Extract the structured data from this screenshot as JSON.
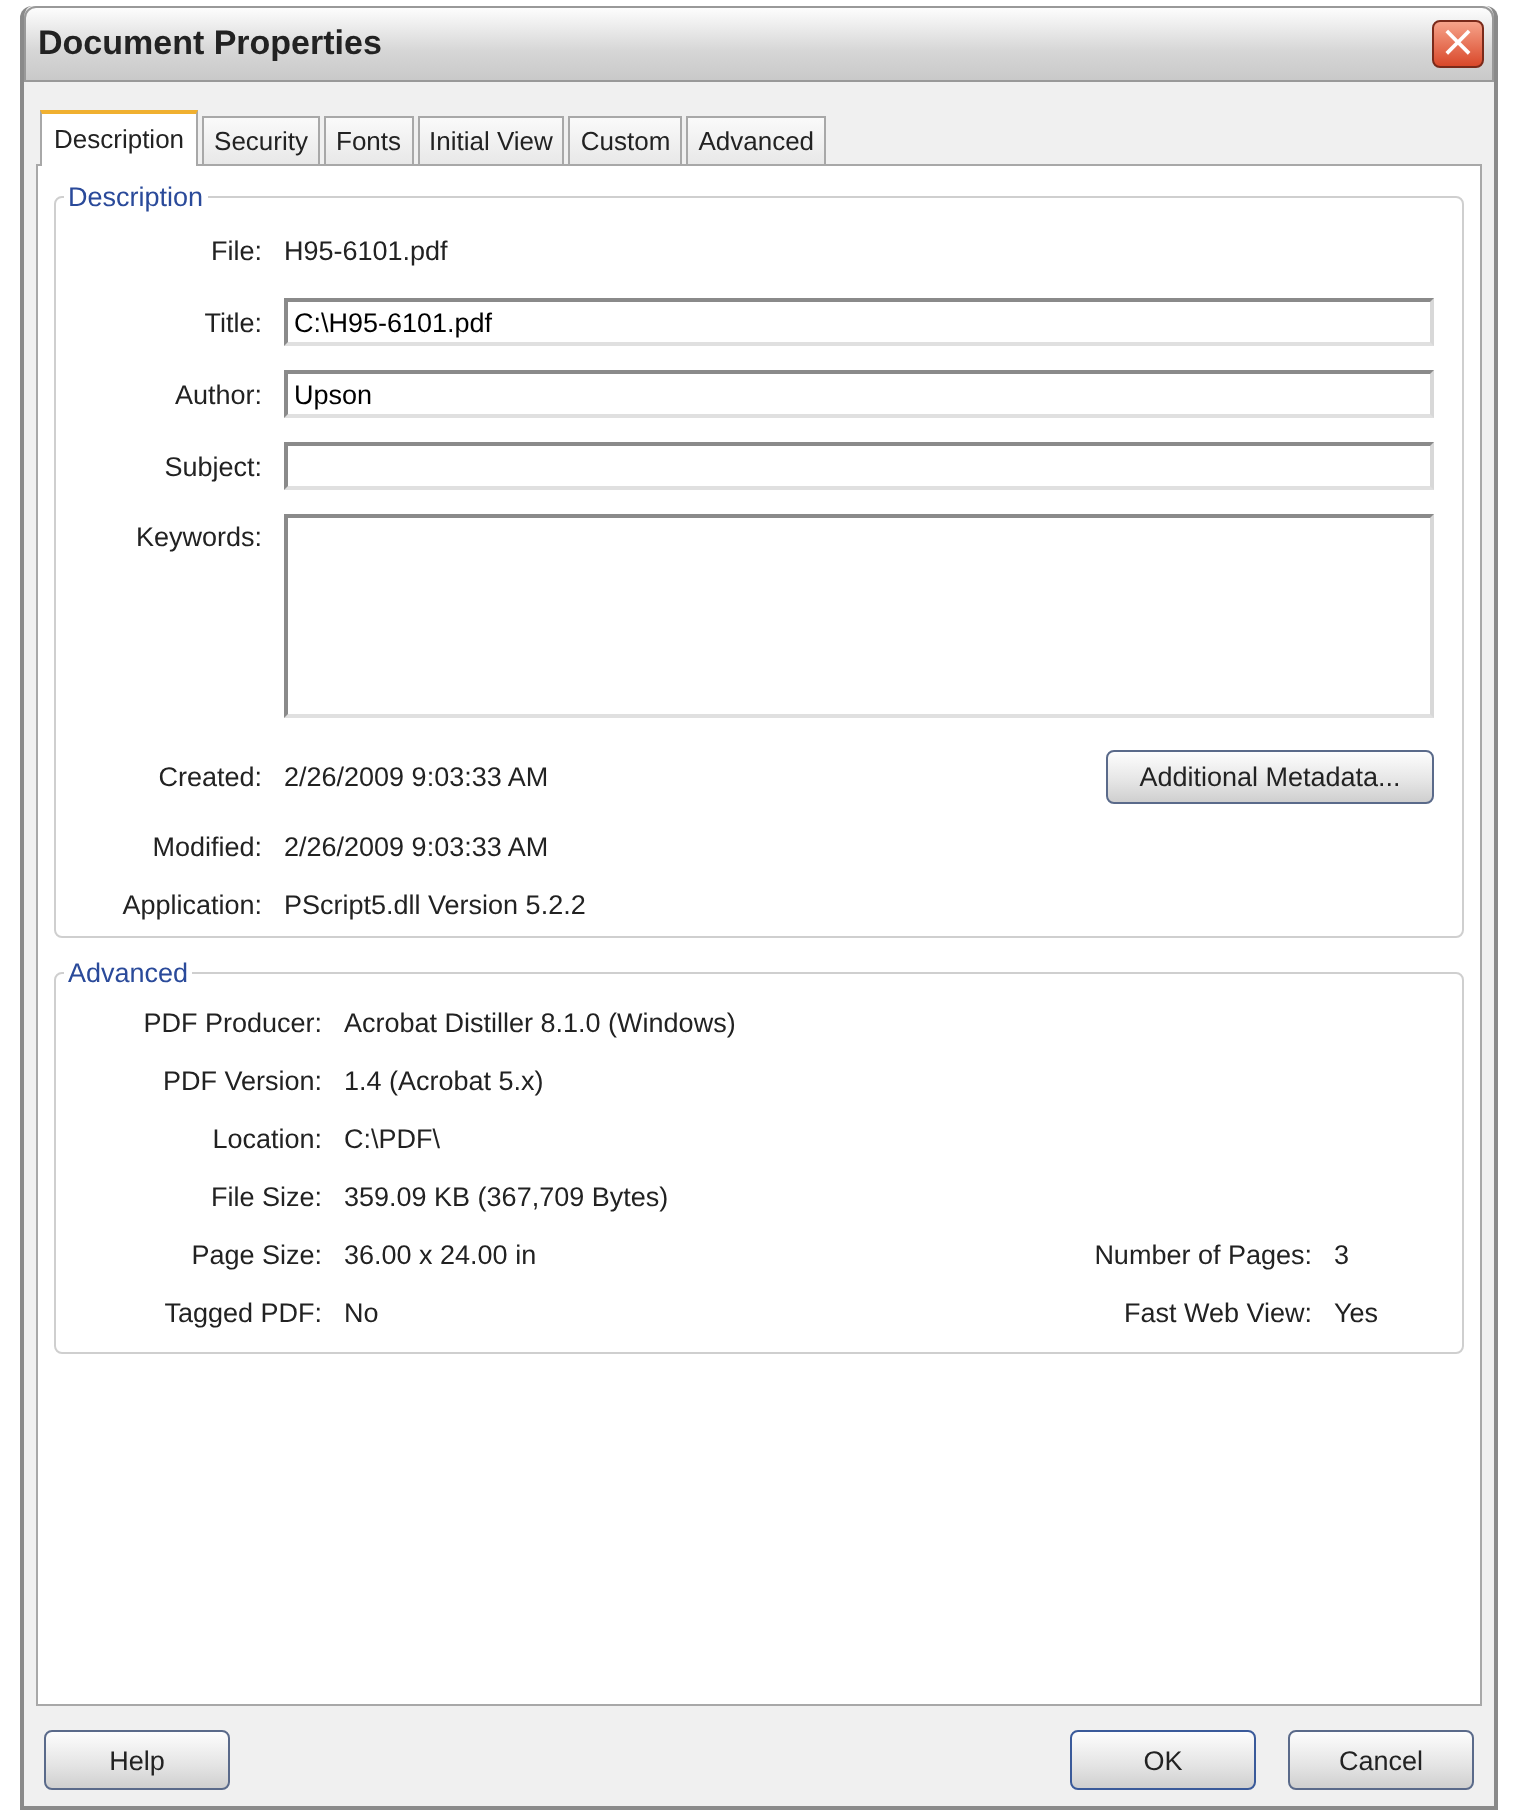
{
  "window": {
    "title": "Document Properties",
    "close": "×"
  },
  "tabs": [
    {
      "label": "Description",
      "selected": true
    },
    {
      "label": "Security",
      "selected": false
    },
    {
      "label": "Fonts",
      "selected": false
    },
    {
      "label": "Initial View",
      "selected": false
    },
    {
      "label": "Custom",
      "selected": false
    },
    {
      "label": "Advanced",
      "selected": false
    }
  ],
  "description": {
    "legend": "Description",
    "fields": [
      {
        "label": "File:",
        "kind": "text",
        "value": "H95-6101.pdf"
      },
      {
        "label": "Title:",
        "kind": "field",
        "value": "C:\\H95-6101.pdf"
      },
      {
        "label": "Author:",
        "kind": "field",
        "value": "Upson"
      },
      {
        "label": "Subject:",
        "kind": "field"
      },
      {
        "label": "Keywords:",
        "kind": "area"
      }
    ],
    "dates": [
      {
        "label": "Created:",
        "value": "2/26/2009 9:03:33 AM"
      },
      {
        "label": "Modified:",
        "value": "2/26/2009 9:03:33 AM"
      },
      {
        "label": "Application:",
        "value": "PScript5.dll Version 5.2.2"
      }
    ],
    "metadata_button": "Additional Metadata..."
  },
  "advanced": {
    "legend": "Advanced",
    "rows": [
      {
        "label": "PDF Producer:",
        "value": "Acrobat Distiller 8.1.0 (Windows)"
      },
      {
        "label": "PDF Version:",
        "value": "1.4 (Acrobat 5.x)"
      },
      {
        "label": "Location:",
        "value": "C:\\PDF\\"
      },
      {
        "label": "File Size:",
        "value": "359.09 KB (367,709 Bytes)"
      },
      {
        "label": "Page Size:",
        "value": "36.00 x 24.00 in",
        "right_label": "Number of Pages:",
        "right_value": "3"
      },
      {
        "label": "Tagged PDF:",
        "value": "No",
        "right_label": "Fast Web View:",
        "right_value": "Yes"
      }
    ]
  },
  "buttons": {
    "help": "Help",
    "ok": "OK",
    "cancel": "Cancel"
  }
}
